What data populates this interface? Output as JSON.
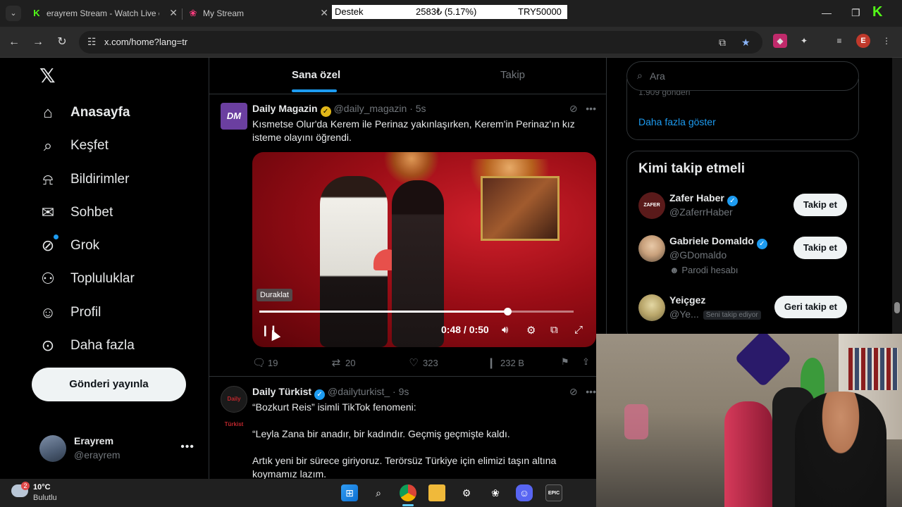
{
  "browser": {
    "tabs": [
      {
        "title": "erayrem Stream - Watch Live o",
        "icon": "kick-icon"
      },
      {
        "title": "My Stream",
        "icon": "stream-icon"
      }
    ],
    "ticker": {
      "left": "Destek",
      "middle": "2583₺ (5.17%)",
      "right": "TRY50000"
    },
    "url": "x.com/home?lang=tr",
    "profile_initial": "E"
  },
  "nav": {
    "items": [
      {
        "label": "Anasayfa",
        "icon": "home-icon"
      },
      {
        "label": "Keşfet",
        "icon": "search-icon"
      },
      {
        "label": "Bildirimler",
        "icon": "bell-icon"
      },
      {
        "label": "Sohbet",
        "icon": "mail-icon"
      },
      {
        "label": "Grok",
        "icon": "grok-icon"
      },
      {
        "label": "Topluluklar",
        "icon": "communities-icon"
      },
      {
        "label": "Profil",
        "icon": "profile-icon"
      },
      {
        "label": "Daha fazla",
        "icon": "more-circle-icon"
      }
    ],
    "post_button": "Gönderi yayınla",
    "user": {
      "name": "Erayrem",
      "handle": "@erayrem"
    }
  },
  "timeline": {
    "tabs": [
      "Sana özel",
      "Takip"
    ],
    "tweets": [
      {
        "name": "Daily Magazin",
        "handle": "@daily_magazin · 5s",
        "avatar_text": "DM",
        "text_line1": "Kısmetse Olur'da Kerem ile Perinaz yakınlaşırken, Kerem'in Perinaz'ın kız",
        "text_line2": "isteme olayını öğrendi.",
        "video": {
          "tooltip": "Duraklat",
          "time": "0:48 / 0:50",
          "progress": 0.79
        },
        "replies": "19",
        "retweets": "20",
        "likes": "323",
        "views": "232 B"
      },
      {
        "name": "Daily Türkist",
        "handle": "@dailyturkist_ · 9s",
        "avatar_text": "Daily Türkist",
        "p1": "“Bozkurt Reis” isimli TikTok fenomeni:",
        "p2": "“Leyla Zana bir anadır, bir kadındır. Geçmiş geçmişte kaldı.",
        "p3a": "Artık yeni bir sürece giriyoruz. Terörsüz Türkiye için elimizi taşın altına",
        "p3b": "koymamız lazım."
      }
    ]
  },
  "right": {
    "search_placeholder": "Ara",
    "faded_trend": "1.909 gönderi",
    "show_more": "Daha fazla göster",
    "who_to_follow_title": "Kimi takip etmeli",
    "suggestions": [
      {
        "name": "Zafer Haber",
        "handle": "@ZaferrHaber",
        "button": "Takip et",
        "avatar_text": "ZAFER"
      },
      {
        "name": "Gabriele Domaldo",
        "handle": "@GDomaldo",
        "extra": "Parodi hesabı",
        "button": "Takip et"
      },
      {
        "name": "Yeiçgez",
        "handle": "@Ye...",
        "follows_you": "Seni takip ediyor",
        "button": "Geri takip et"
      }
    ]
  },
  "taskbar": {
    "temp": "10°C",
    "condition": "Bulutlu",
    "weather_badge": "2"
  },
  "colors": {
    "accent": "#1d9bf0",
    "background": "#000000",
    "kick_green": "#53fc18"
  }
}
